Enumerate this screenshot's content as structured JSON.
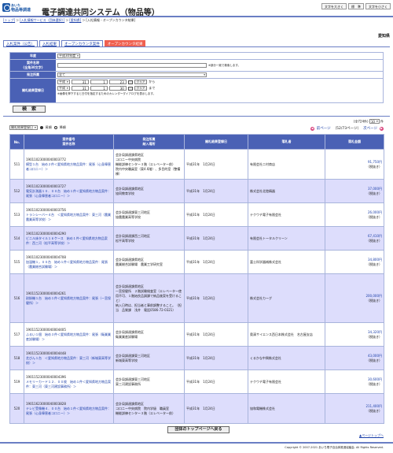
{
  "header": {
    "logo_top": "あいち",
    "logo_sub": "物品等調達",
    "title": "電子調達共同システム（物品等）",
    "font_buttons": [
      "文字を大きく",
      "標　準",
      "文字を小さく"
    ]
  },
  "breadcrumb": [
    "[トップ]",
    "＞",
    "[入札情報サービス（団体選択）]",
    "＞",
    "[愛知県]",
    "＞",
    "[入札情報 - オープンカウンタ結果]"
  ],
  "prefecture": "愛知県",
  "tabs": [
    "入札案件（公告）",
    "入札結果",
    "オープンカウンタ案件",
    "オープンカウンタ結果"
  ],
  "search": {
    "fiscal_year_label": "年度",
    "fiscal_year_value": "平成30年度",
    "case_name_label1": "案件名称",
    "case_name_label2": "(全角30文字)",
    "case_name_note": "※部分一致で検索します。",
    "dept_label": "発注所属",
    "dept_value": "全て",
    "date_label": "開札結果登録日",
    "from": {
      "era": "平成",
      "y": "31",
      "m": "1",
      "d": "23",
      "cal": "カレンダー",
      "clear": "クリア",
      "suffix": "から"
    },
    "to": {
      "era": "平成",
      "y": "31",
      "m": "1",
      "d": "30",
      "cal": "カレンダー",
      "clear": "クリア",
      "suffix": "まで"
    },
    "date_note": "※画像を押下すると日付を指定するためのカレンダーダイアログを表示します。",
    "button": "検　索"
  },
  "sort": {
    "field": "開札結果登録日",
    "asc": "昇順",
    "desc": "降順"
  },
  "paging": {
    "summary": "(全724件)",
    "per_page": "10",
    "per_page_suffix": "件",
    "prev": "前ページ",
    "page_info": "（52/73ページ）",
    "next": "次ページ"
  },
  "table": {
    "headers": [
      "No.",
      "案件番号\n案件名称",
      "発注所属\n納入場所",
      "開札結果登録日",
      "落札者",
      "落札金額"
    ],
    "rows": [
      {
        "no": "511",
        "case_no": "19011023000040003772",
        "case_name": "模型１台　始め２件＜愛知県地方物品案件：尾張（心身障害者コロニー）＞",
        "dept": "会計局調達課県地区\nコロニー中央病院\n機能訓練センター３階（エレベーター前）\n院内中央職員室（東4.6階）、多目的室（整備棟）",
        "date": "平成31年　1月24日",
        "winner": "有限会社二村商店",
        "amount": "91,750円",
        "tax": "（税抜き）"
      },
      {
        "no": "512",
        "case_no": "19011023000040003727",
        "case_name": "電気計測器１０．００台　始め１件＜愛知県地方物品案件：尾張（心身障害者コロニー）＞",
        "dept": "会計局調達課県地区\n協同教育学校",
        "date": "平成31年　1月24日",
        "winner": "株式会社北陸精器",
        "amount": "37,000円",
        "tax": "（税抜き）"
      },
      {
        "no": "513",
        "case_no": "19011023000040003756",
        "case_name": "トランシーバー４台　＜愛知県地方物品案件：東三河（農業農業高等学校）＞",
        "dept": "会計局調達課東三河地区\n協農農業高等学校",
        "date": "平成31年　1月24日",
        "winner": "テクウチ電子有限会社",
        "amount": "26,000円",
        "tax": "（税抜き）"
      },
      {
        "no": "514",
        "case_no": "19011023000040004290",
        "case_name": "ビニル床タイル１６ケース　始め１件＜愛知県地方物品案件：西三河（松平高等学校）＞",
        "dept": "会計局調達課西三河地区\n松平高等学校",
        "date": "平成31年　1月24日",
        "winner": "有限会社トータルクリーン",
        "amount": "67,410円",
        "tax": "（税抜き）"
      },
      {
        "no": "515",
        "case_no": "19011023000040004708",
        "case_name": "加湿機１，００台　始め１件＜愛知県地方物品案件：尾張（農業総合試験場）＞",
        "dept": "会計局調達課県地区\n農業総合試験場　農業工学研究室",
        "date": "平成31年　1月24日",
        "winner": "富士科学器械株式会社",
        "amount": "34,800円",
        "tax": "（税抜き）"
      },
      {
        "no": "516",
        "case_no": "19011523000040004261",
        "case_name": "耐掛機１台　始め１件＜愛知県地方物品案件：尾張（一宮保健所）＞",
        "dept": "会計局調達課県地区\n一宮保健所　２階試験検査室（エレベーター使用不可、１階始良品調課で納品後案を受けること）\n納入日時は、担当者と事前調整すること。（担当　品質課　浅井　電話0586-72-0321）",
        "date": "平成31年　1月24日",
        "winner": "株式会社カーグ",
        "amount": "200,000円",
        "tax": "（税抜き）"
      },
      {
        "no": "517",
        "case_no": "19011523000040004405",
        "case_name": "ふるい１個　始め３件＜愛知県地方物品案件：尾張（衛業業産試験場）＞",
        "dept": "会計局調達課県地区\n衛業業産試験場",
        "date": "平成31年　1月24日",
        "winner": "奥清サイエンス西日本株式会社　名古屋支店",
        "amount": "34,320円",
        "tax": "（税抜き）"
      },
      {
        "no": "518",
        "case_no": "19011523000040004448",
        "case_name": "芝びん１台　＜愛知県地方物品案件：東三河（新城東高等学校）＞",
        "dept": "会計局調達課東三河地区\n新城東高等学校",
        "date": "平成31年　1月24日",
        "winner": "くるかな中興株式会社",
        "amount": "43,000円",
        "tax": "（税抜き）"
      },
      {
        "no": "519",
        "case_no": "19011523000040004396",
        "case_name": "メモリーカード１２．００枚　始め１件＜愛知県地方物品案件：東三河（東三河建設事務所）＞",
        "dept": "会計局調達課東三河地区\n東三河建設事務所",
        "date": "平成31年　1月24日",
        "winner": "テクウチ電子有限会社",
        "amount": "30,600円",
        "tax": "（税抜き）"
      },
      {
        "no": "520",
        "case_no": "19011623000040003828",
        "case_name": "テレビ受像機４．００台　始め１件＜愛知県地方物品案件：尾張（心身障害者コロニー）＞",
        "dept": "会計局調達課県地区\nコロニー中央病院　院内学級　職員室\n機能訓練センター３階（エレベーター前）",
        "date": "平成31年　1月24日",
        "winner": "協和電機株式会社",
        "amount": "211,400円",
        "tax": "（税抜き）"
      }
    ]
  },
  "back_button": "団体のトップページへ戻る",
  "page_top": "▲ページトップへ",
  "footer": "Copyright © 2007-2021 あいち電子自治体推進協議会. All Rights Reserved."
}
